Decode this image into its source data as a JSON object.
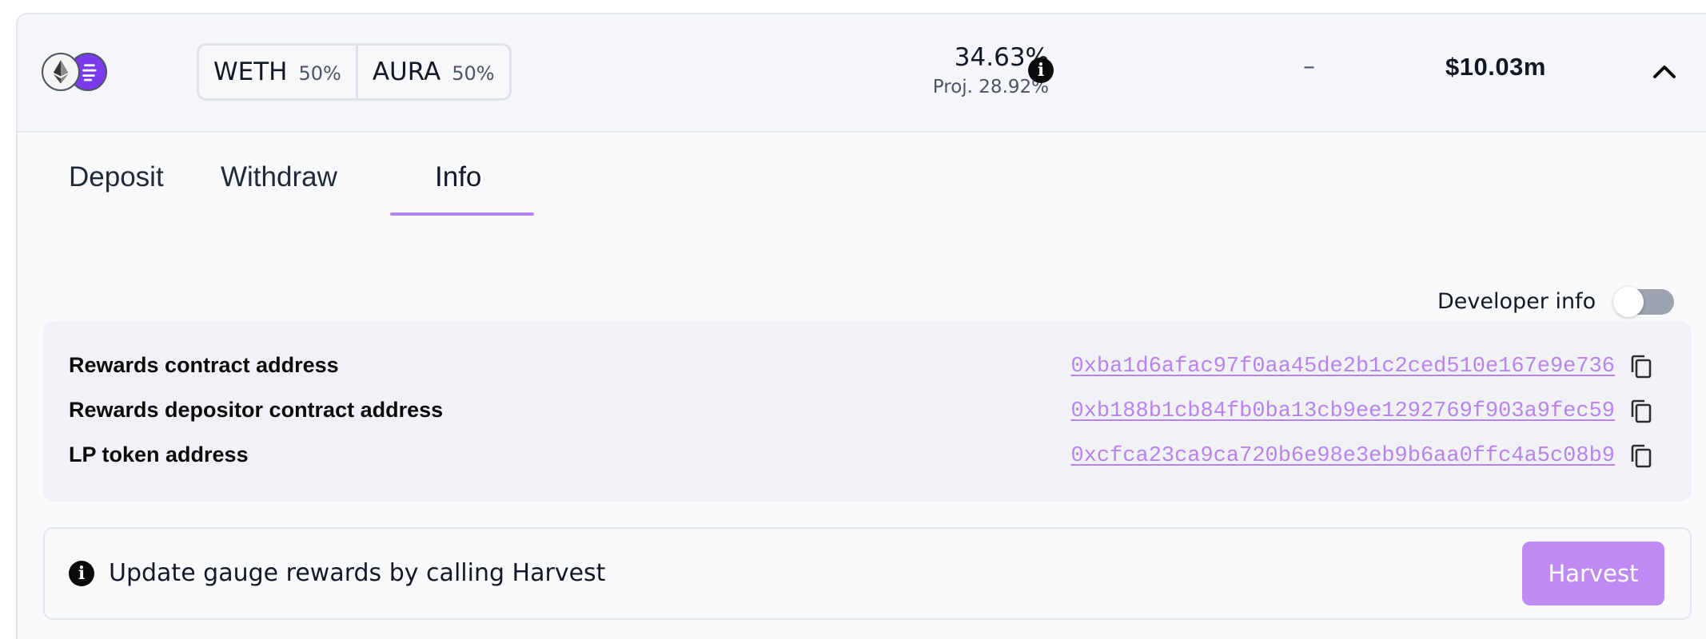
{
  "pool": {
    "tokens": [
      {
        "symbol": "WETH",
        "weight": "50%"
      },
      {
        "symbol": "AURA",
        "weight": "50%"
      }
    ],
    "apr": "34.63%",
    "projected_apr": "Proj. 28.92%",
    "my_deposit": "–",
    "tvl": "$10.03m",
    "icons": {
      "token_a": "ethereum-logo-icon",
      "token_b": "aura-logo-icon",
      "apr_info": "info-icon",
      "collapse": "chevron-up-icon"
    }
  },
  "tabs": [
    {
      "label": "Deposit",
      "active": false
    },
    {
      "label": "Withdraw",
      "active": false
    },
    {
      "label": "Info",
      "active": true
    }
  ],
  "developer_info": {
    "label": "Developer info",
    "enabled": false
  },
  "addresses": [
    {
      "label": "Rewards contract address",
      "value": "0xba1d6afac97f0aa45de2b1c2ced510e167e9e736"
    },
    {
      "label": "Rewards depositor contract address",
      "value": "0xb188b1cb84fb0ba13cb9ee1292769f903a9fec59"
    },
    {
      "label": "LP token address",
      "value": "0xcfca23ca9ca720b6e98e3eb9b6aa0ffc4a5c08b9"
    }
  ],
  "notice": {
    "text": "Update gauge rewards by calling Harvest",
    "button_label": "Harvest"
  },
  "colors": {
    "accent": "#c08af3",
    "link": "#b983ee",
    "tab_underline": "#b983ee"
  }
}
